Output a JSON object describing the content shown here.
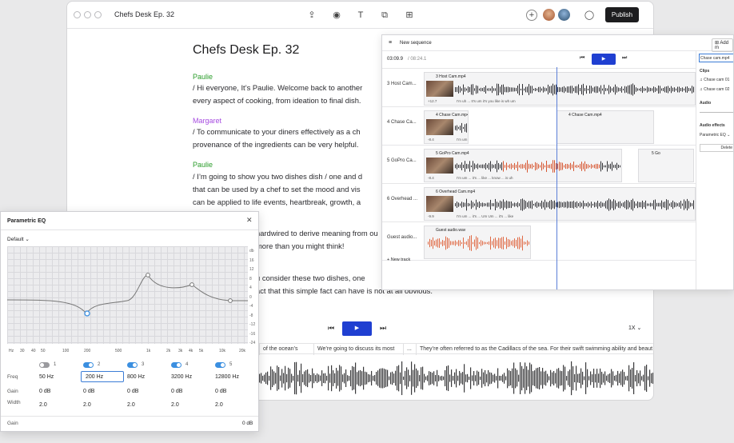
{
  "doc": {
    "title": "Chefs Desk Ep. 32",
    "window_title": "Chefs Desk Ep. 32",
    "publish_label": "Publish",
    "blocks": [
      {
        "speaker": "Paulie",
        "color": "#2a9d2a",
        "lines": [
          "/ Hi everyone, It’s Paulie. Welcome back to another",
          "every aspect of cooking, from ideation to final dish."
        ]
      },
      {
        "speaker": "Margaret",
        "color": "#a64be0",
        "lines": [
          "/ To communicate to your diners effectively as a ch",
          "provenance of the ingredients can be very helpful."
        ]
      },
      {
        "speaker": "Paulie",
        "color": "#2a9d2a",
        "lines": [
          "/ I’m going to show you two dishes dish / one and d",
          "that can be used by a chef to set the mood and vis",
          "can be applied to life events, heartbreak, growth, a"
        ]
      }
    ],
    "hidden_lines": [
      "hardwired to derive meaning from ou",
      "more than you might think!",
      "u consider these two dishes, one",
      "act that this simple fact can have is not at all obvious."
    ],
    "speed": "1X",
    "segments": [
      "of the ocean’s",
      "We’re going to discuss its most",
      "...",
      "They’re often referred to as the Cadillacs of the sea. For their swift swimming ability and beaut"
    ]
  },
  "sequence": {
    "title": "New sequence",
    "add_label": "Add m",
    "timecode": "03:09.9",
    "duration": "/ 08:24.1",
    "new_track": "+ New track",
    "tracks": [
      {
        "label": "3 Host Cam...",
        "clip": "3 Host Cam.mp4",
        "gain": "+12.7",
        "words": "I'm  uh  ...  It's  um  it's  you  like  is  wh  um"
      },
      {
        "label": "4 Chase Ca...",
        "clip": "4 Chase Cam.mp4",
        "gain": "-8.4",
        "words": "I'm  um  ...  it's  ...  like  ...  is  uh"
      },
      {
        "label": "5 GoPro Ca...",
        "clip": "5 GoPro Cam.mp4",
        "gain": "-8.4",
        "words": "I'm  um  ...  it's  ...  like  ...  know  ...  is  uh"
      },
      {
        "label": "6 Overhead ...",
        "clip": "6 Overhead Cam.mp4",
        "gain": "-9.9",
        "words": "I'm  um  ...  it's  ...  Um  Um  ...  it's  ...  like"
      },
      {
        "label": "Guest audio...",
        "clip": "Guest audio.wav",
        "gain": "",
        "words": ""
      }
    ],
    "extra_clips": [
      "4 Chase Cam.mp4",
      "5 Go",
      "-8.4"
    ],
    "sidebar": {
      "selected": "Chase cam.mp4",
      "clips_heading": "Clips",
      "clips": [
        "Chase cam 01",
        "Chase cam 02"
      ],
      "audio_heading": "Audio",
      "effects_heading": "Audio effects",
      "effect": "Parametric EQ",
      "delete": "Delete"
    }
  },
  "eq": {
    "title": "Parametric EQ",
    "preset": "Default",
    "y_ticks": [
      "db",
      "16",
      "12",
      "8",
      "4",
      "0",
      "-4",
      "-8",
      "-12",
      "-16",
      "-24"
    ],
    "x_ticks": [
      "Hz",
      "30",
      "40",
      "50",
      "100",
      "200",
      "500",
      "1k",
      "2k",
      "3k",
      "4k",
      "5k",
      "10k",
      "20k"
    ],
    "bands": [
      {
        "num": "1",
        "on": false,
        "freq": "50 Hz",
        "gain": "0 dB",
        "width": "2.0"
      },
      {
        "num": "2",
        "on": true,
        "freq": "200 Hz",
        "gain": "0 dB",
        "width": "2.0"
      },
      {
        "num": "3",
        "on": true,
        "freq": "800 Hz",
        "gain": "0 dB",
        "width": "2.0"
      },
      {
        "num": "4",
        "on": true,
        "freq": "3200 Hz",
        "gain": "0 dB",
        "width": "2.0"
      },
      {
        "num": "5",
        "on": true,
        "freq": "12800 Hz",
        "gain": "0 dB",
        "width": "2.0"
      }
    ],
    "row_labels": {
      "freq": "Freq",
      "gain": "Gain",
      "width": "Width"
    },
    "master_label": "Gain",
    "master_value": "0 dB",
    "accent": "#3b8fe0"
  }
}
